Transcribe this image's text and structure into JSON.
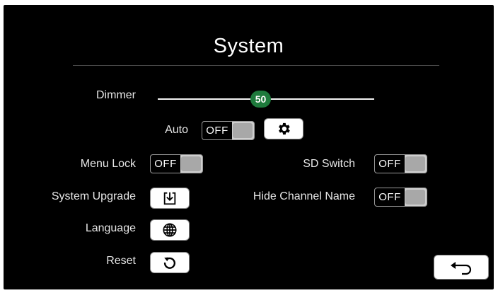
{
  "header": {
    "title": "System"
  },
  "dimmer": {
    "label": "Dimmer",
    "value": "50",
    "level_percent": 50
  },
  "auto": {
    "label": "Auto",
    "state": "OFF",
    "settings_icon": "gear-icon"
  },
  "menu_lock": {
    "label": "Menu Lock",
    "state": "OFF"
  },
  "sd_switch": {
    "label": "SD Switch",
    "state": "OFF"
  },
  "system_upgrade": {
    "label": "System Upgrade",
    "icon": "download-icon"
  },
  "hide_channel_name": {
    "label": "Hide Channel Name",
    "state": "OFF"
  },
  "language": {
    "label": "Language",
    "icon": "globe-icon"
  },
  "reset": {
    "label": "Reset",
    "icon": "refresh-icon"
  },
  "footer": {
    "back_icon": "back-arrow-icon"
  },
  "colors": {
    "background": "#000000",
    "accent": "#1e7a3c",
    "text": "#ffffff"
  }
}
